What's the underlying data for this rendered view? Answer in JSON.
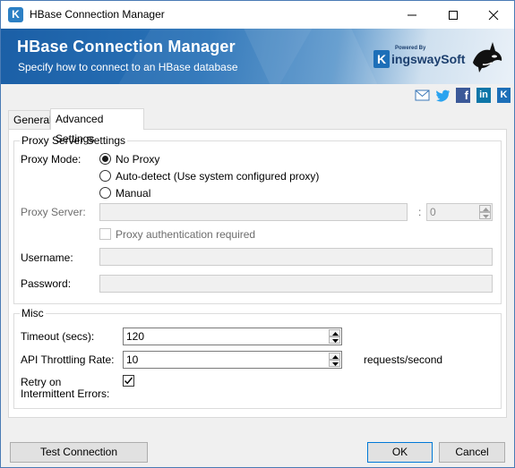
{
  "window": {
    "title": "HBase Connection Manager",
    "icon_letter": "K"
  },
  "banner": {
    "title": "HBase Connection Manager",
    "subtitle": "Specify how to connect to an HBase database",
    "logo_powered": "Powered By",
    "logo_letter": "K",
    "logo_name": "ingswaySoft"
  },
  "social": {
    "icons": [
      "mail-icon",
      "twitter-icon",
      "facebook-icon",
      "linkedin-icon",
      "kingswaysoft-icon"
    ],
    "facebook_glyph": "f",
    "linkedin_glyph": "in",
    "kingsway_glyph": "K"
  },
  "tabs": {
    "general": "General",
    "advanced": "Advanced Settings",
    "active": "Advanced Settings"
  },
  "proxy": {
    "group_title": "Proxy Server Settings",
    "mode_label": "Proxy Mode:",
    "options": [
      "No Proxy",
      "Auto-detect (Use system configured proxy)",
      "Manual"
    ],
    "selected": "No Proxy",
    "server_label": "Proxy Server:",
    "server_value": "",
    "port_separator": ":",
    "port_value": "0",
    "auth_label": "Proxy authentication required",
    "auth_checked": false,
    "username_label": "Username:",
    "username_value": "",
    "password_label": "Password:",
    "password_value": ""
  },
  "misc": {
    "group_title": "Misc",
    "timeout_label": "Timeout (secs):",
    "timeout_value": "120",
    "throttle_label": "API Throttling Rate:",
    "throttle_value": "10",
    "throttle_unit": "requests/second",
    "retry_label_line1": "Retry on",
    "retry_label_line2": "Intermittent Errors:",
    "retry_checked": true
  },
  "buttons": {
    "test": "Test Connection",
    "ok": "OK",
    "cancel": "Cancel"
  }
}
